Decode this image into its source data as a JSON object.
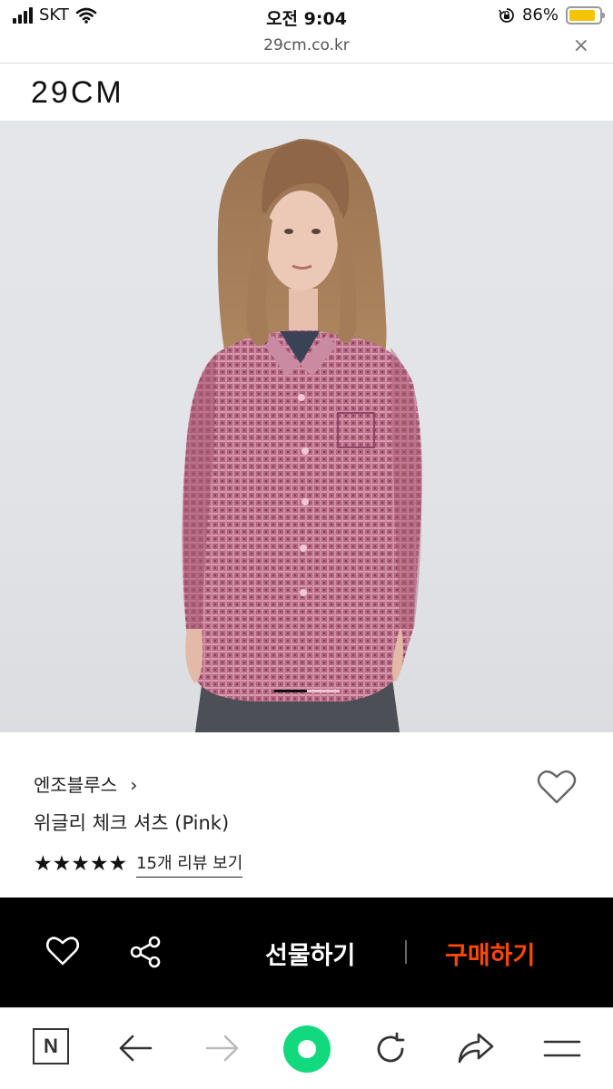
{
  "status_bar": {
    "carrier": "SKT",
    "time": "오전 9:04",
    "battery": "86%",
    "battery_level": 0.86,
    "icons": [
      "signal-icon",
      "wifi-icon",
      "rotation-lock-icon",
      "battery-icon"
    ]
  },
  "browser": {
    "url": "29cm.co.kr",
    "close_icon": "×"
  },
  "header": {
    "logo": "29CM"
  },
  "product": {
    "image_indicator": {
      "current": 1,
      "total": 2
    },
    "brand": "엔조블루스",
    "brand_chevron": "›",
    "name": "위글리 체크 셔츠 (Pink)",
    "rating": 5,
    "stars": "★★★★★",
    "review_link": "15개 리뷰 보기",
    "wish_icon": "heart-outline-icon"
  },
  "purchase_bar": {
    "heart_icon": "heart-icon",
    "share_icon": "share-icon",
    "gift_label": "선물하기",
    "buy_label": "구매하기",
    "buy_color": "#ff4800"
  },
  "toolbar": {
    "items": [
      "naver-n-icon",
      "back-arrow-icon",
      "forward-arrow-icon",
      "green-home-icon",
      "refresh-icon",
      "share-arrow-icon",
      "menu-icon"
    ],
    "accent": "#13d97e"
  }
}
